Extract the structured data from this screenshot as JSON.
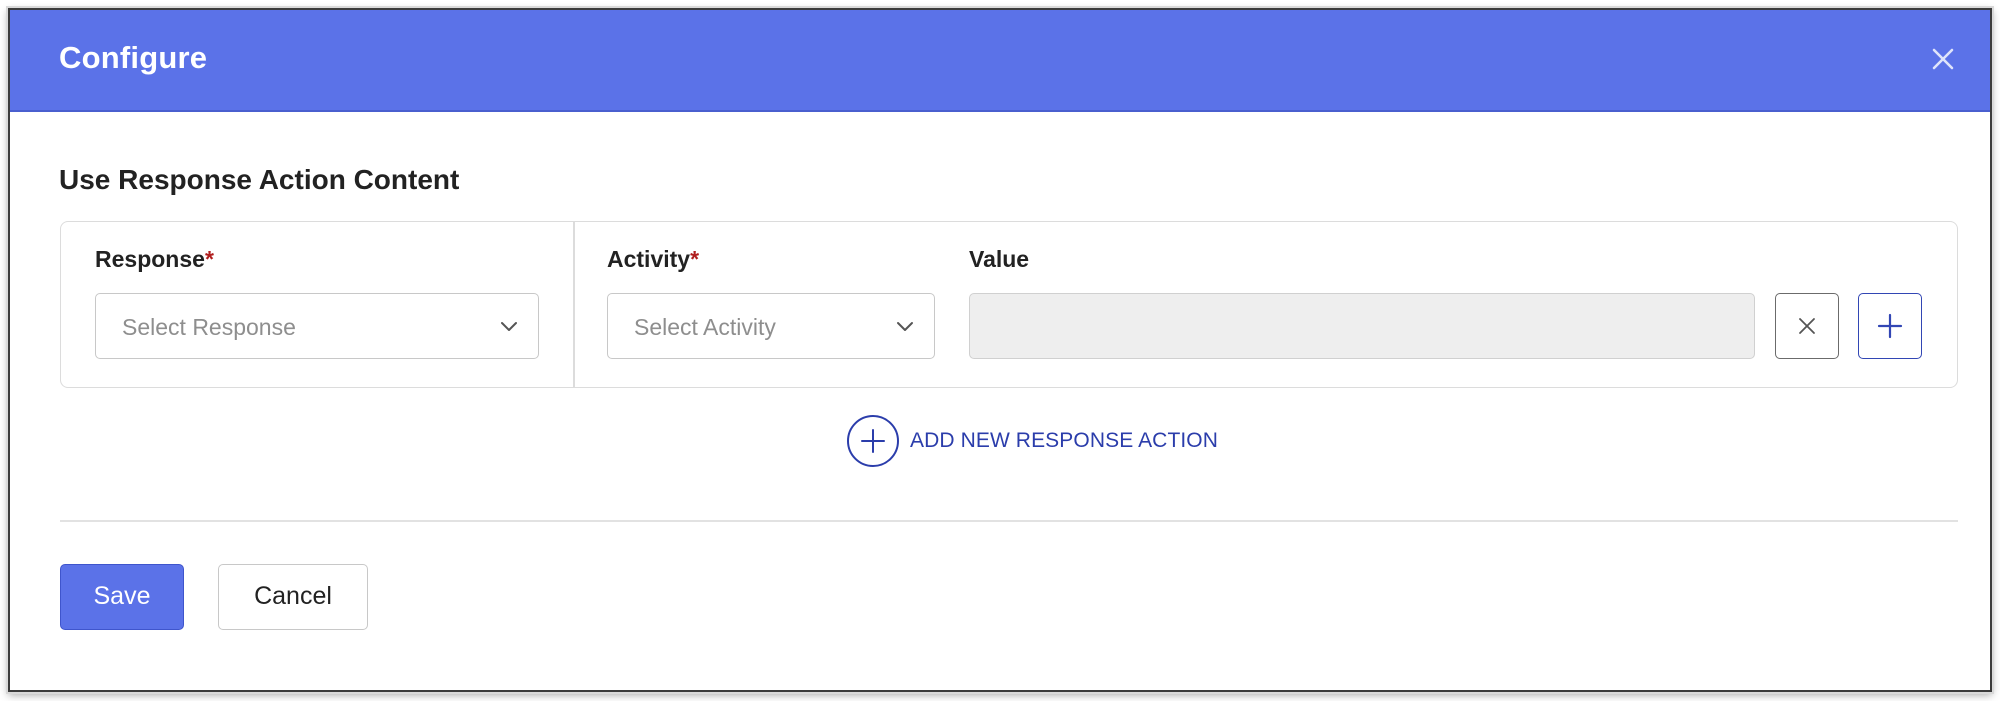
{
  "dialog": {
    "title": "Configure",
    "close_icon": "close-icon",
    "accent_color": "#5b72e8"
  },
  "section": {
    "title": "Use Response Action Content"
  },
  "response_action": {
    "response": {
      "label": "Response",
      "required_mark": "*",
      "placeholder": "Select Response",
      "icon": "chevron-down-icon"
    },
    "activity": {
      "label": "Activity",
      "required_mark": "*",
      "placeholder": "Select Activity",
      "icon": "chevron-down-icon"
    },
    "value": {
      "label": "Value",
      "value": ""
    },
    "remove_icon": "close-icon",
    "add_icon": "plus-icon"
  },
  "add_response_action": {
    "label": "ADD NEW RESPONSE ACTION",
    "icon": "plus-circle-icon"
  },
  "footer": {
    "save_label": "Save",
    "cancel_label": "Cancel"
  }
}
